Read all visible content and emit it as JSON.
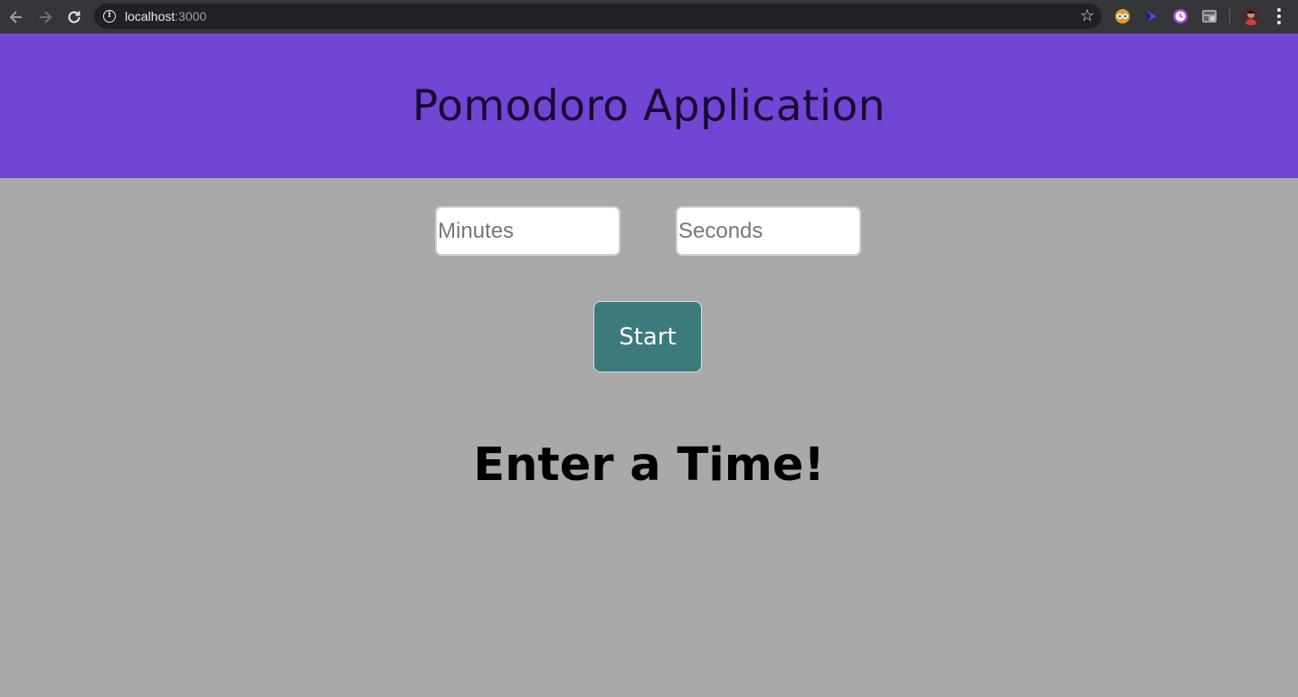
{
  "browser": {
    "url_host": "localhost",
    "url_port": ":3000",
    "extensions": [
      "eyes-extension-icon",
      "cursor-extension-icon",
      "clock-extension-icon",
      "grid-extension-icon"
    ]
  },
  "colors": {
    "header_bg": "#7345d4",
    "page_bg": "#a9a9a9",
    "start_button_bg": "#3b7a7d"
  },
  "header": {
    "title": "Pomodoro Application"
  },
  "inputs": {
    "minutes_placeholder": "Minutes",
    "seconds_placeholder": "Seconds"
  },
  "controls": {
    "start_label": "Start"
  },
  "status": {
    "message": "Enter a Time!"
  }
}
